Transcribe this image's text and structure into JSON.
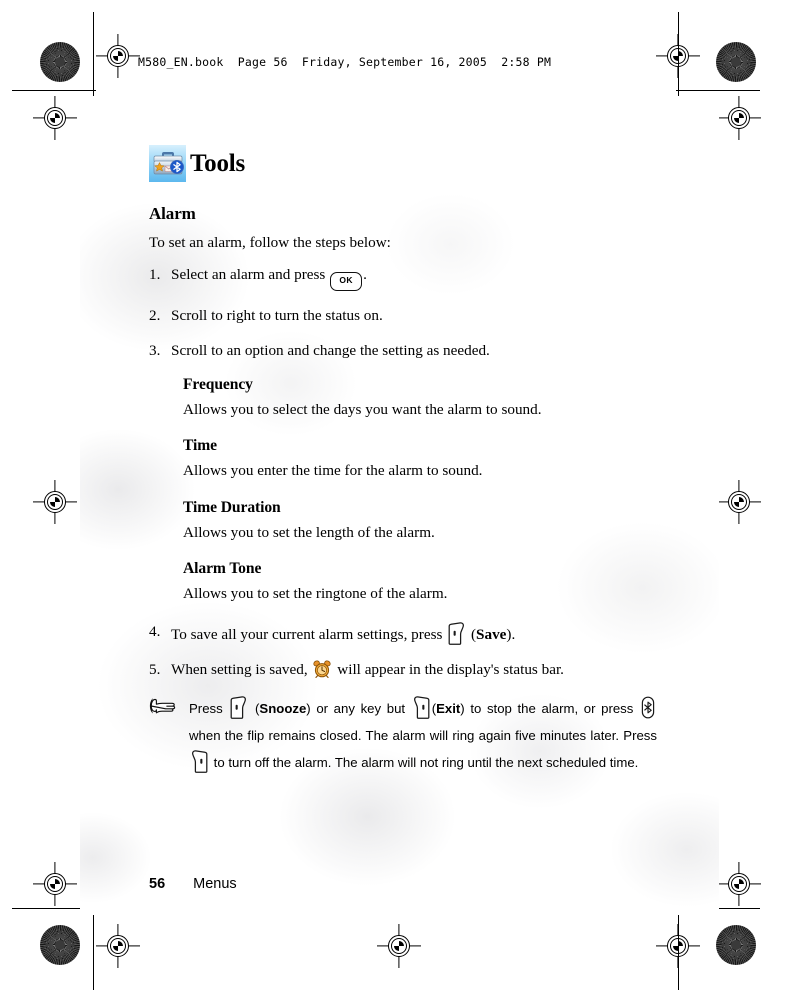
{
  "header_stamp": "M580_EN.book  Page 56  Friday, September 16, 2005  2:58 PM",
  "chapter": {
    "icon": "toolbox-bluetooth-icon",
    "title": "Tools"
  },
  "section": {
    "heading": "Alarm",
    "intro": "To set an alarm, follow the steps below:"
  },
  "steps": [
    {
      "num": "1.",
      "before": "Select an alarm and press",
      "key": "ok-key",
      "key_label": "OK",
      "after": "."
    },
    {
      "num": "2.",
      "before": "Scroll to right to turn the status on.",
      "key": null,
      "after": ""
    },
    {
      "num": "3.",
      "before": "Scroll to an option and change the setting as needed.",
      "key": null,
      "after": ""
    }
  ],
  "options": [
    {
      "name": "Frequency",
      "desc": "Allows you to select the days you want the alarm to sound."
    },
    {
      "name": "Time",
      "desc": "Allows you enter the time for the alarm to sound."
    },
    {
      "name": "Time Duration",
      "desc": "Allows you to set the length of the alarm."
    },
    {
      "name": "Alarm Tone",
      "desc": "Allows you to set the ringtone of the alarm."
    }
  ],
  "steps_cont": [
    {
      "num": "4.",
      "before": "To save all your current alarm settings, press",
      "key": "left-softkey",
      "mid": "(",
      "bold": "Save",
      "after": ")."
    },
    {
      "num": "5.",
      "before": "When setting is saved,",
      "key": "alarm-clock-icon",
      "after": "will appear in the display's status bar."
    }
  ],
  "note": {
    "icon": "pointing-hand-icon",
    "p1_a": "Press",
    "p1_key": "left-softkey",
    "p1_b": "(",
    "p1_bold1": "Snooze",
    "p1_c": ")  or any key but",
    "p1_key2": "right-softkey",
    "p1_d": "(",
    "p1_bold2": "Exit",
    "p1_e": ") to stop the alarm, or press",
    "p1_key3": "side-bluetooth-key",
    "p1_f": "when the flip remains closed. The alarm will ring again five minutes later. Press",
    "p1_key4": "right-softkey",
    "p1_g": "to turn off the alarm. The alarm will not ring until the next scheduled time."
  },
  "footer": {
    "page_number": "56",
    "label": "Menus"
  },
  "colors": {
    "icon_blue_light": "#bfe6fb",
    "icon_blue_dark": "#63bdef",
    "alarm_orange": "#e8922a",
    "ink": "#000000"
  }
}
